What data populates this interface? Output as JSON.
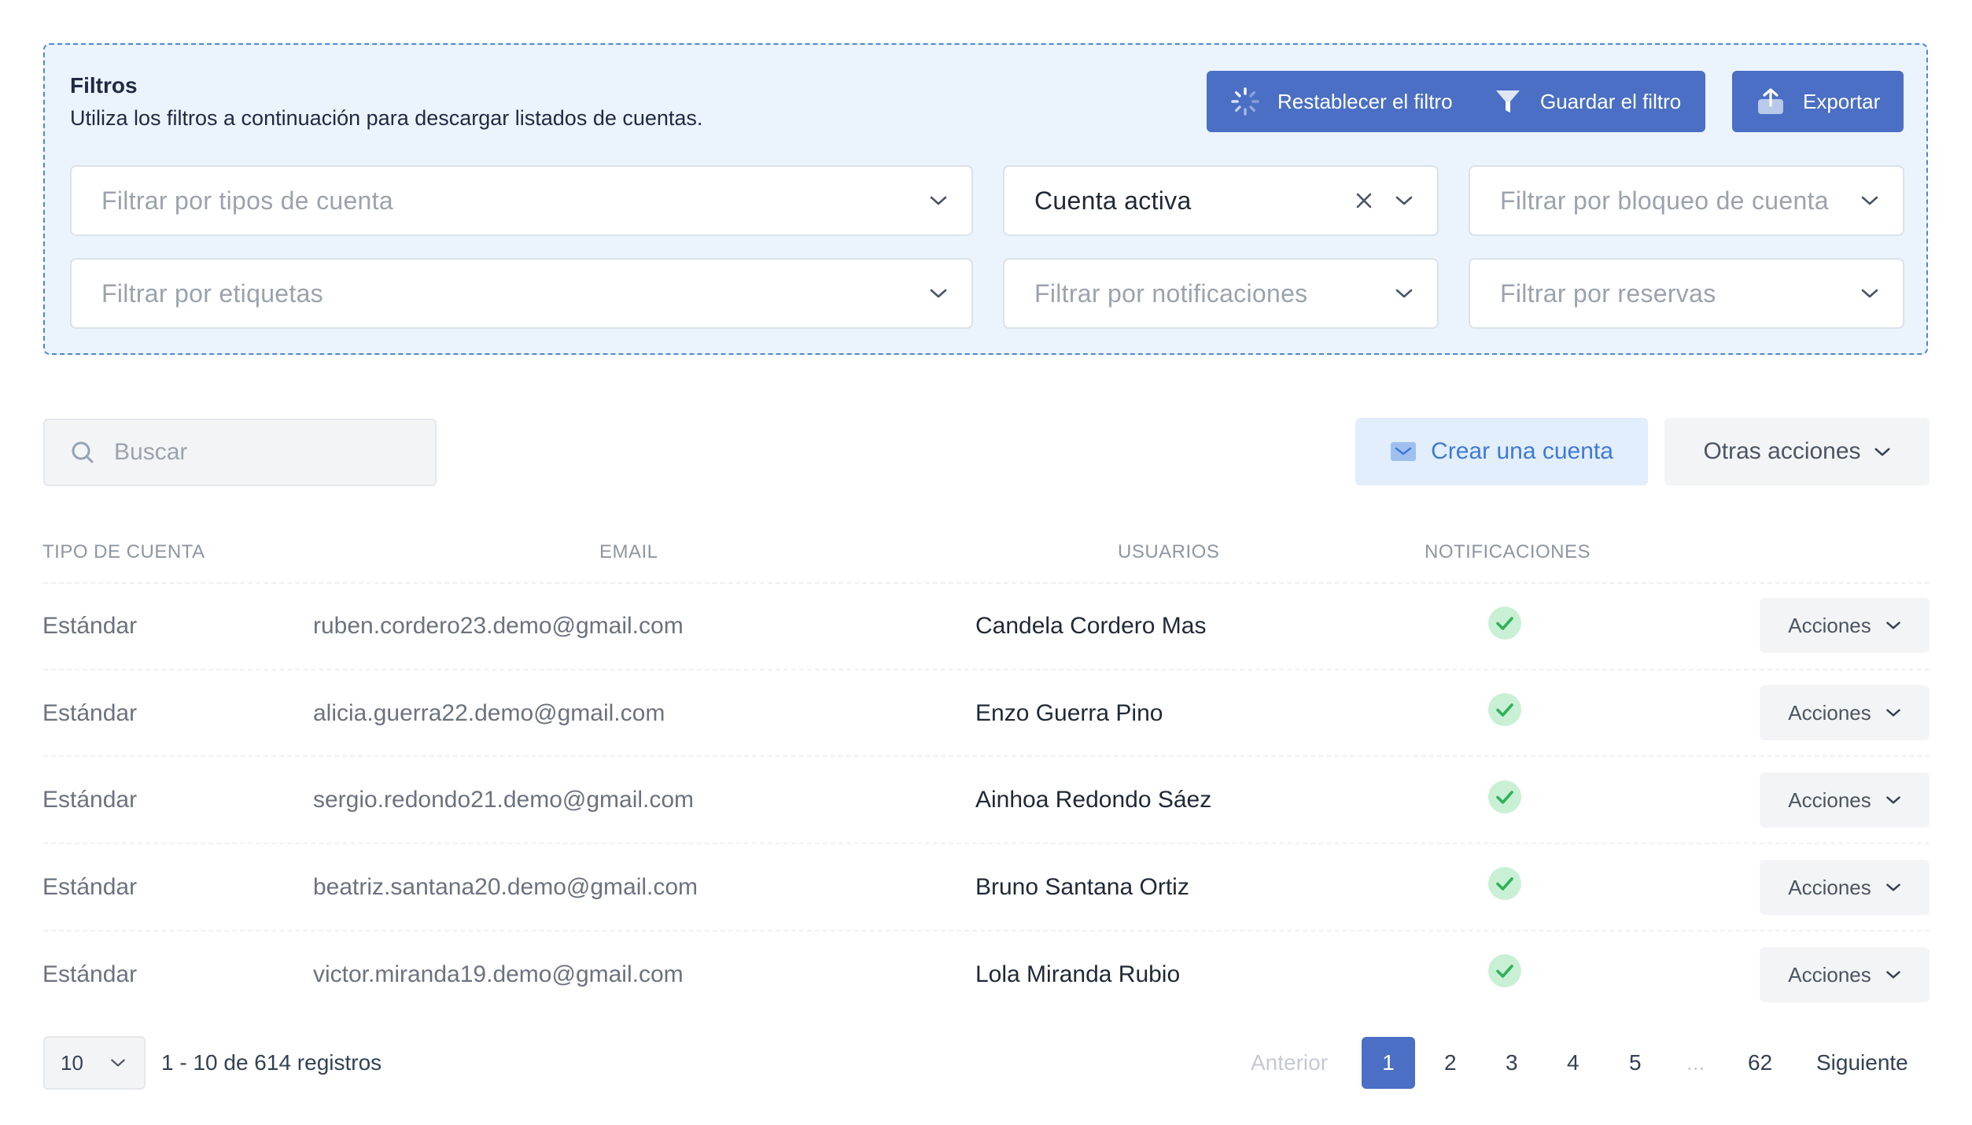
{
  "filters": {
    "title": "Filtros",
    "description": "Utiliza los filtros a continuación para descargar listados de cuentas.",
    "buttons": {
      "reset": "Restablecer el filtro",
      "save": "Guardar el filtro",
      "export": "Exportar"
    },
    "selects": {
      "account_types": "Filtrar por tipos de cuenta",
      "account_status": "Cuenta activa",
      "account_lock": "Filtrar por bloqueo de cuenta",
      "tags": "Filtrar por etiquetas",
      "notifications": "Filtrar por notificaciones",
      "bookings": "Filtrar por reservas"
    }
  },
  "toolbar": {
    "search_placeholder": "Buscar",
    "create_label": "Crear una cuenta",
    "other_actions_label": "Otras acciones"
  },
  "table": {
    "headers": {
      "type": "TIPO DE CUENTA",
      "email": "EMAIL",
      "users": "USUARIOS",
      "notifications": "NOTIFICACIONES"
    },
    "rows": [
      {
        "type": "Estándar",
        "email": "ruben.cordero23.demo@gmail.com",
        "user": "Candela Cordero Mas",
        "notifications": true,
        "action": "Acciones"
      },
      {
        "type": "Estándar",
        "email": "alicia.guerra22.demo@gmail.com",
        "user": "Enzo Guerra Pino",
        "notifications": true,
        "action": "Acciones"
      },
      {
        "type": "Estándar",
        "email": "sergio.redondo21.demo@gmail.com",
        "user": "Ainhoa Redondo Sáez",
        "notifications": true,
        "action": "Acciones"
      },
      {
        "type": "Estándar",
        "email": "beatriz.santana20.demo@gmail.com",
        "user": "Bruno Santana Ortiz",
        "notifications": true,
        "action": "Acciones"
      },
      {
        "type": "Estándar",
        "email": "victor.miranda19.demo@gmail.com",
        "user": "Lola Miranda Rubio",
        "notifications": true,
        "action": "Acciones"
      }
    ]
  },
  "pagination": {
    "per_page": "10",
    "summary": "1 - 10 de 614 registros",
    "previous": "Anterior",
    "pages": [
      "1",
      "2",
      "3",
      "4",
      "5"
    ],
    "current_page": "1",
    "ellipsis": "...",
    "last_page": "62",
    "next": "Siguiente"
  },
  "colors": {
    "primary": "#4a6fc4",
    "panel_bg": "#ebf3fd",
    "panel_border": "#4f86d9",
    "check_bg": "#c9f0d4",
    "check_mark": "#2fb259",
    "create_bg": "#e3eefc",
    "create_text": "#3e7ad6"
  },
  "icons": {
    "reset": "spinner-icon",
    "save": "funnel-icon",
    "export": "upload-icon",
    "search": "search-icon",
    "create": "envelope-icon",
    "dropdown": "chevron-down-icon",
    "clear": "close-icon",
    "notification_on": "check-circle-icon"
  }
}
